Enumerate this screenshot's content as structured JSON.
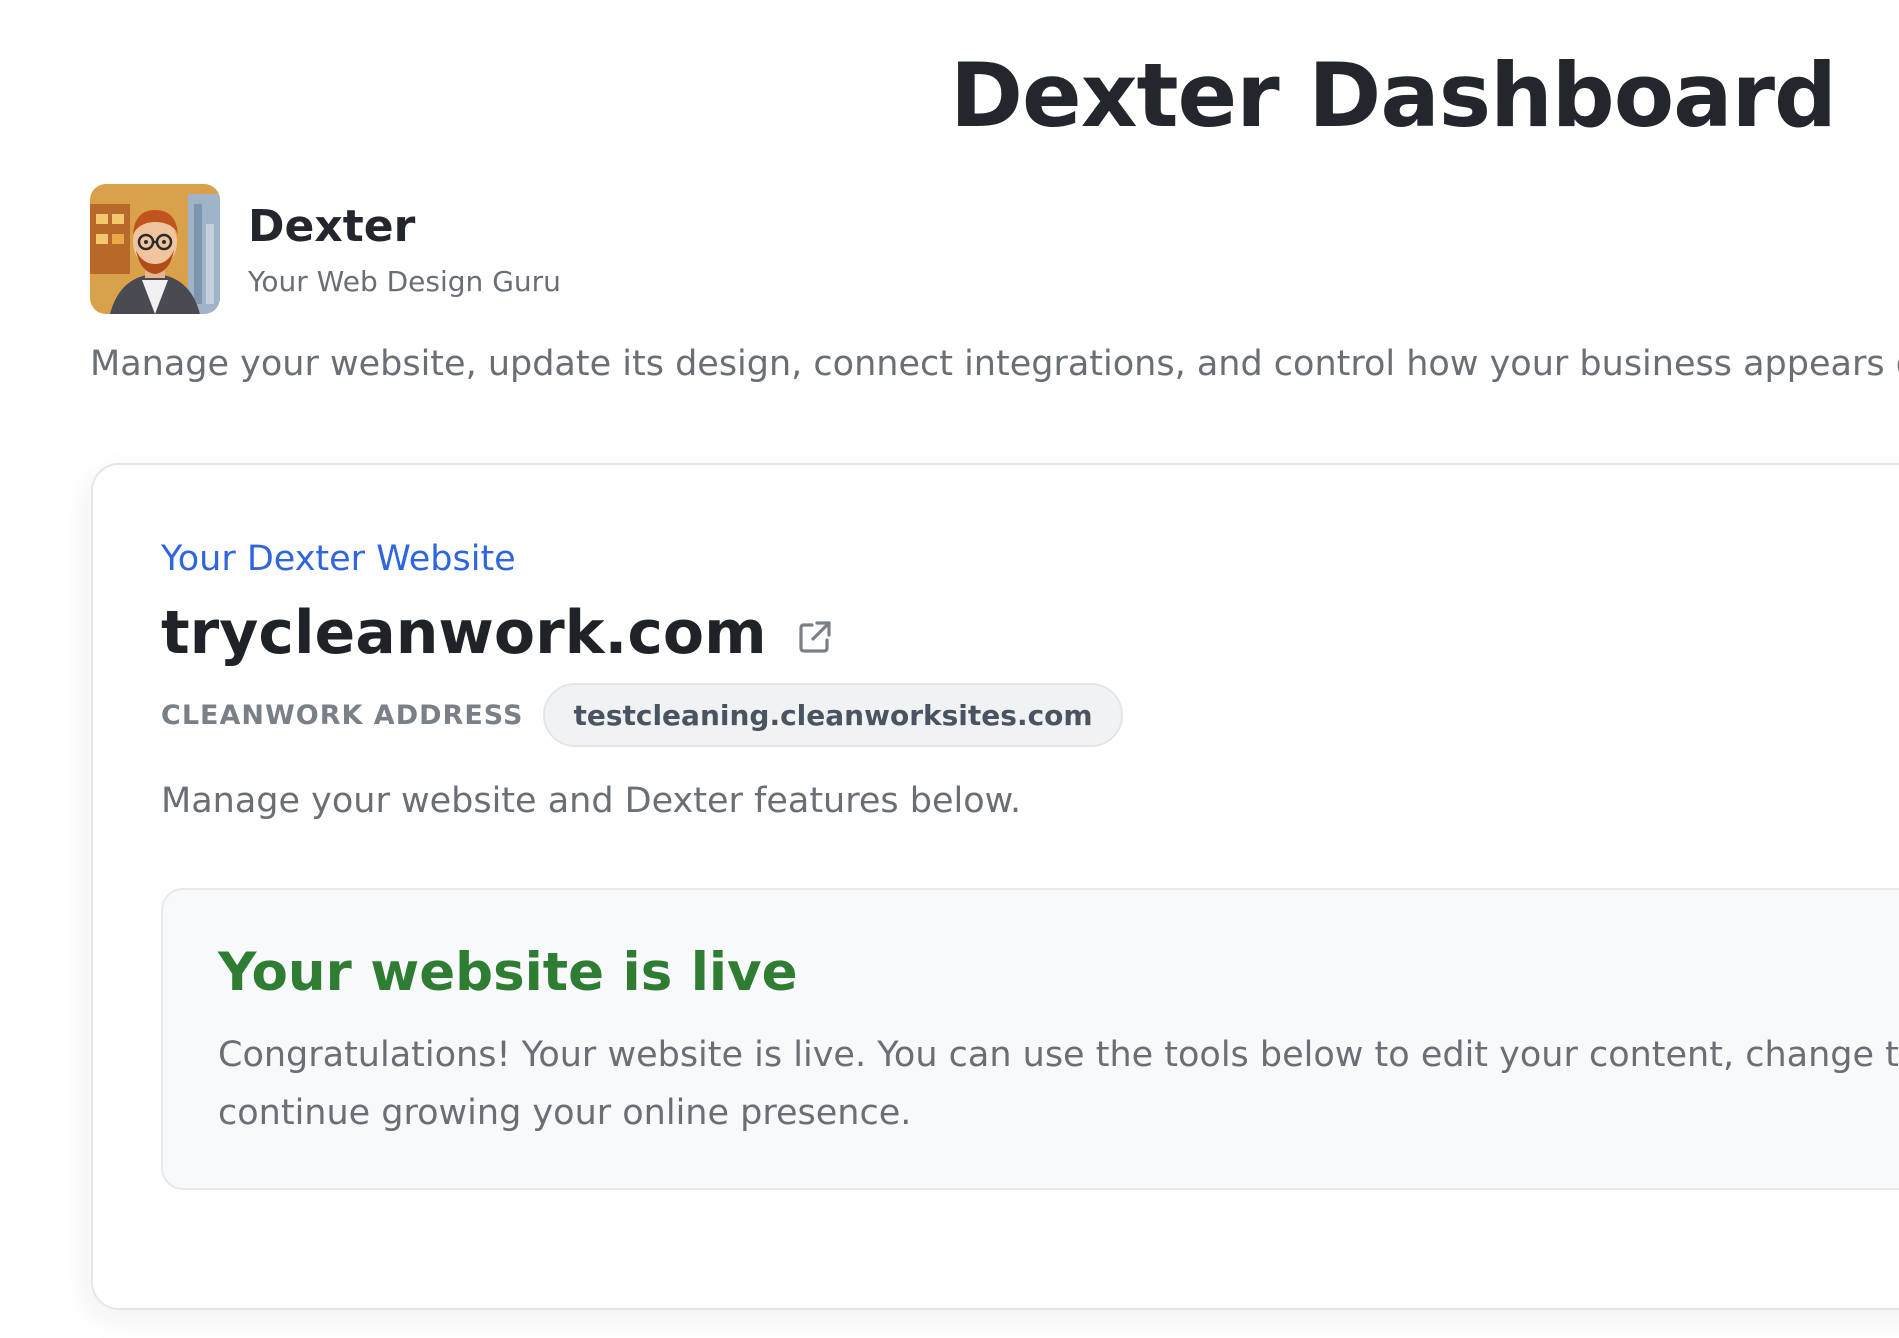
{
  "page": {
    "title": "Dexter Dashboard"
  },
  "agent": {
    "name": "Dexter",
    "tagline": "Your Web Design Guru",
    "avatar_icon": "avatar-portrait"
  },
  "intro": "Manage your website, update its design, connect integrations, and control how your business appears onli",
  "website_card": {
    "eyebrow": "Your Dexter Website",
    "domain": "trycleanwork.com",
    "external_link_icon": "external-link-icon",
    "address_label": "CLEANWORK ADDRESS",
    "address_value": "testcleaning.cleanworksites.com",
    "description": "Manage your website and Dexter features below."
  },
  "status": {
    "title": "Your website is live",
    "body": "Congratulations! Your website is live. You can use the tools below to edit your content, change temp continue growing your online presence.",
    "title_color": "#2e7d32"
  },
  "colors": {
    "accent": "#2f66e0",
    "success": "#2e7d32",
    "muted_text": "#6a6f75"
  }
}
